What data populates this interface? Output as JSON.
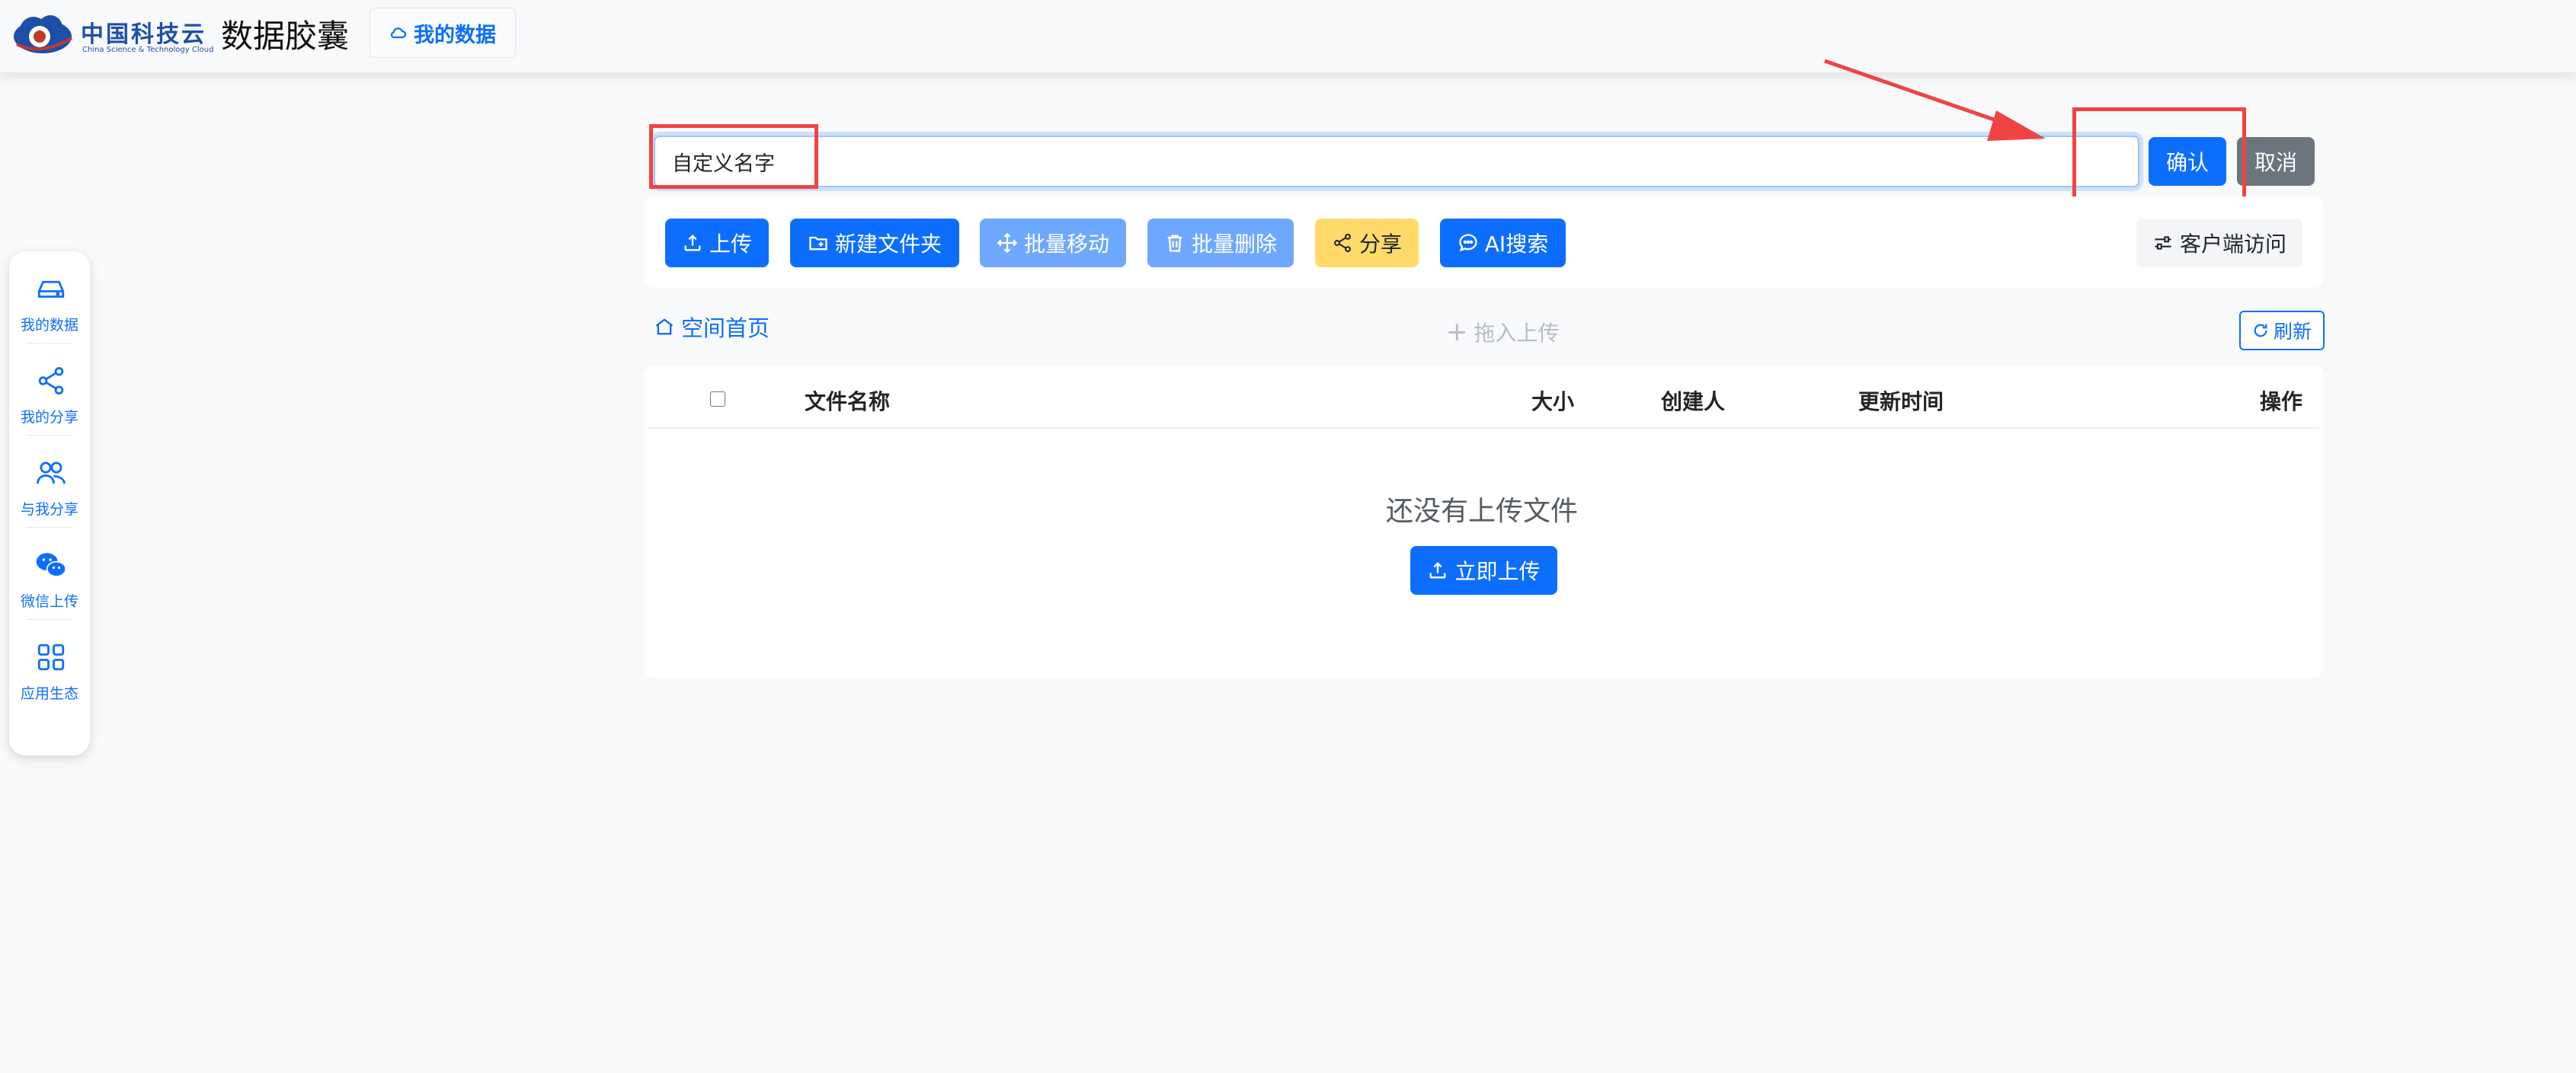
{
  "header": {
    "logo_text_cn": "中国科技云",
    "logo_text_en": "China Science & Technology Cloud",
    "app_title": "数据胶囊",
    "my_data_tab": "我的数据"
  },
  "sidebar": {
    "items": [
      {
        "label": "我的数据",
        "icon": "drive-icon"
      },
      {
        "label": "我的分享",
        "icon": "share-icon"
      },
      {
        "label": "与我分享",
        "icon": "users-icon"
      },
      {
        "label": "微信上传",
        "icon": "wechat-icon"
      },
      {
        "label": "应用生态",
        "icon": "grid-icon"
      }
    ]
  },
  "rename": {
    "value": "自定义名字",
    "confirm": "确认",
    "cancel": "取消"
  },
  "toolbar": {
    "upload": "上传",
    "new_folder": "新建文件夹",
    "batch_move": "批量移动",
    "batch_delete": "批量删除",
    "share": "分享",
    "ai_search": "AI搜索",
    "client_access": "客户端访问"
  },
  "breadcrumb": {
    "home": "空间首页"
  },
  "dropzone": "拖入上传",
  "refresh": "刷新",
  "table": {
    "columns": [
      "文件名称",
      "大小",
      "创建人",
      "更新时间",
      "操作"
    ],
    "empty_text": "还没有上传文件",
    "upload_now": "立即上传"
  },
  "colors": {
    "primary": "#0d6efd",
    "primary_disabled": "#6ea8fe",
    "warning": "#ffda6a",
    "secondary": "#6c757d",
    "annotation": "#ef4444"
  }
}
